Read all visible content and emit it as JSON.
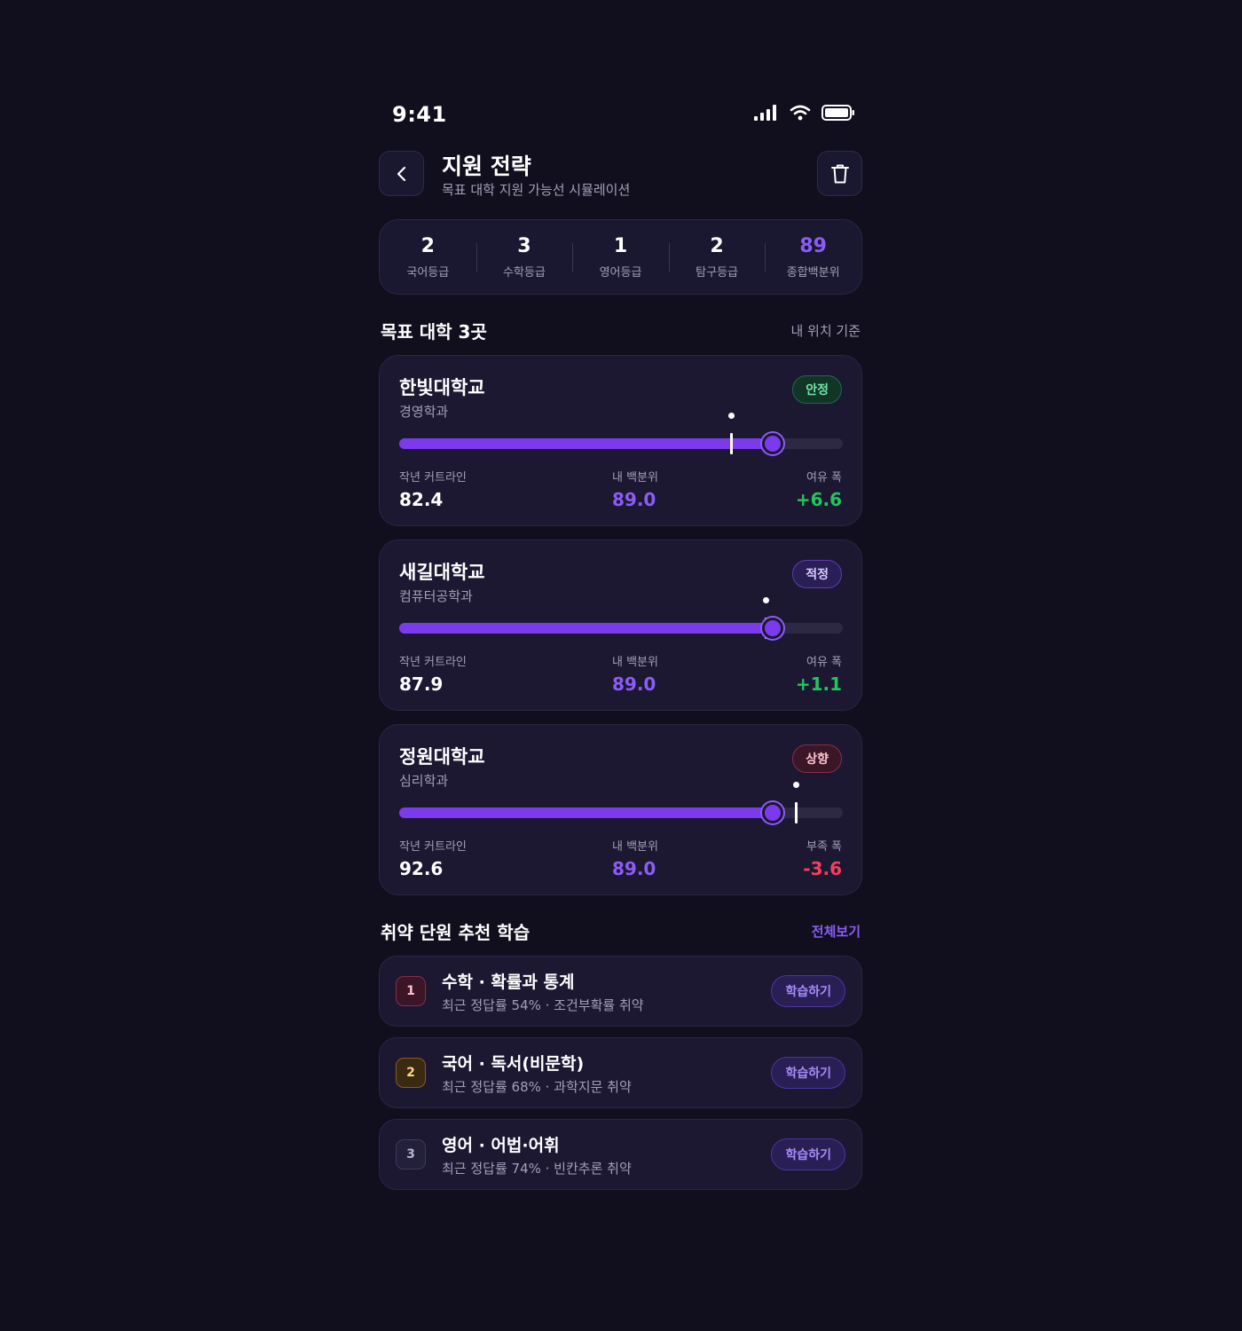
{
  "status_bar": {
    "time": "9:41"
  },
  "header": {
    "title": "지원 전략",
    "subtitle": "목표 대학 지원 가능선 시뮬레이션"
  },
  "grades": [
    {
      "value": "2",
      "label": "국어등급"
    },
    {
      "value": "3",
      "label": "수학등급"
    },
    {
      "value": "1",
      "label": "영어등급"
    },
    {
      "value": "2",
      "label": "탐구등급"
    },
    {
      "value": "89",
      "label": "종합백분위"
    }
  ],
  "targets": {
    "title": "목표 대학 3곳",
    "meta": "내 위치 기준",
    "schools": [
      {
        "name": "한빛대학교",
        "dept": "경영학과",
        "badge": "안정",
        "badge_kind": "safe",
        "cutoff_label": "작년 커트라인",
        "cutoff": "82.4",
        "cutoff_num": 82.4,
        "mine_label": "내 백분위",
        "mine": "89.0",
        "mine_num": 89.0,
        "gap_label": "여유 폭",
        "gap": "+6.6"
      },
      {
        "name": "새길대학교",
        "dept": "컴퓨터공학과",
        "badge": "적정",
        "badge_kind": "fit",
        "cutoff_label": "작년 커트라인",
        "cutoff": "87.9",
        "cutoff_num": 87.9,
        "mine_label": "내 백분위",
        "mine": "89.0",
        "mine_num": 89.0,
        "gap_label": "여유 폭",
        "gap": "+1.1"
      },
      {
        "name": "정원대학교",
        "dept": "심리학과",
        "badge": "상향",
        "badge_kind": "reach",
        "cutoff_label": "작년 커트라인",
        "cutoff": "92.6",
        "cutoff_num": 92.6,
        "mine_label": "내 백분위",
        "mine": "89.0",
        "mine_num": 89.0,
        "gap_label": "부족 폭",
        "gap": "-3.6"
      }
    ]
  },
  "study": {
    "title": "취약 단원 추천 학습",
    "view_all": "전체보기",
    "items": [
      {
        "rank": "1",
        "title": "수학 · 확률과 통계",
        "sub": "최근 정답률 54% · 조건부확률 취약",
        "button": "학습하기"
      },
      {
        "rank": "2",
        "title": "국어 · 독서(비문학)",
        "sub": "최근 정답률 68% · 과학지문 취약",
        "button": "학습하기"
      },
      {
        "rank": "3",
        "title": "영어 · 어법·어휘",
        "sub": "최근 정답률 74% · 빈칸추론 취약",
        "button": "학습하기"
      }
    ]
  },
  "colors": {
    "background": "#110f1d",
    "accent": "#7c3aed",
    "positive": "#22c55e",
    "negative": "#f43f5e"
  },
  "icons": [
    "back-chevron-icon",
    "trash-icon",
    "signal-icon",
    "wifi-icon",
    "battery-icon"
  ]
}
